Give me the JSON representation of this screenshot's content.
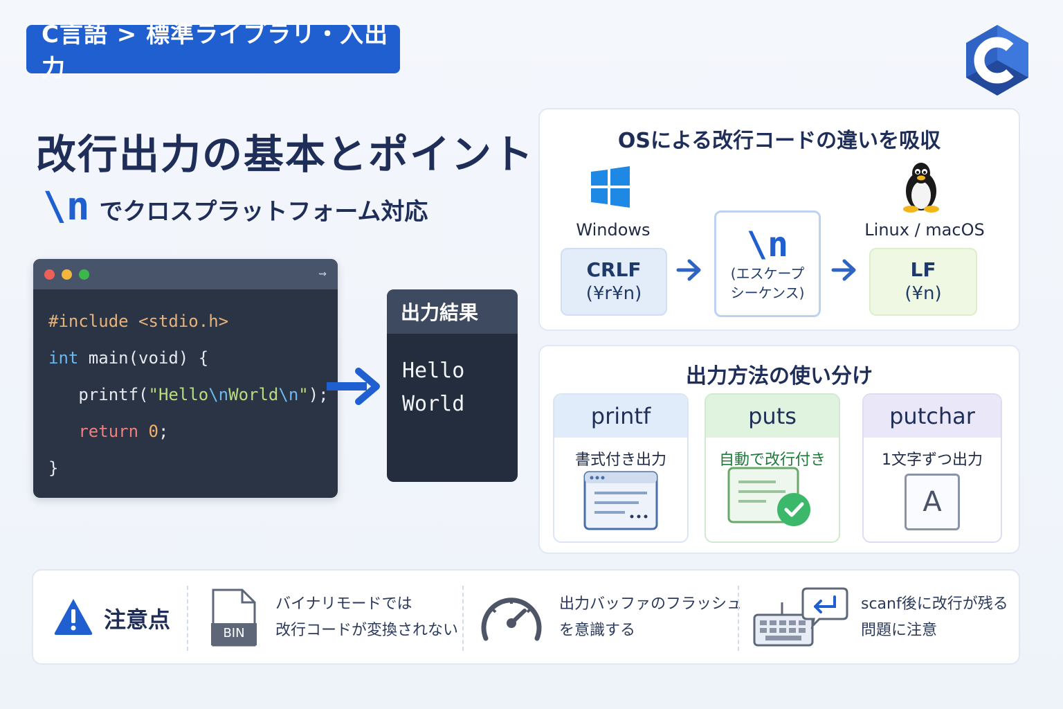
{
  "breadcrumb": "C言語 > 標準ライブラリ・入出力",
  "logo_icon": "c-language-logo",
  "title": "改行出力の基本とポイント",
  "subtitle": {
    "escape": "\\n",
    "text": "でクロスプラットフォーム対応"
  },
  "code": {
    "include": "#include <stdio.h>",
    "main_kw": "int",
    "main_rest": " main(void) {",
    "printf_fn": "printf(",
    "printf_str1": "\"Hello",
    "printf_esc1": "\\n",
    "printf_str2": "World",
    "printf_esc2": "\\n",
    "printf_str3": "\"",
    "printf_end": ");",
    "return_kw": "return",
    "return_val": "0",
    "return_end": ";",
    "close": "}"
  },
  "output": {
    "header": "出力結果",
    "line1": "Hello",
    "line2": "World"
  },
  "os_panel": {
    "title": "OSによる改行コードの違いを吸収",
    "windows_label": "Windows",
    "windows_code": "CRLF",
    "windows_seq": "(¥r¥n)",
    "escape_big": "\\n",
    "escape_line1": "(エスケープ",
    "escape_line2": "シーケンス)",
    "unix_label": "Linux / macOS",
    "unix_code": "LF",
    "unix_seq": "(¥n)"
  },
  "methods_panel": {
    "title": "出力方法の使い分け",
    "methods": [
      {
        "name": "printf",
        "desc": "書式付き出力",
        "color": "#dfeafb",
        "border": "#cfdcf1"
      },
      {
        "name": "puts",
        "desc": "自動で改行付き",
        "color": "#dff3df",
        "border": "#c8e8c8"
      },
      {
        "name": "putchar",
        "desc": "1文字ずつ出力",
        "color": "#e8e6f8",
        "border": "#d8d6ef"
      }
    ],
    "putchar_letter": "A"
  },
  "notes": {
    "heading": "注意点",
    "bin_label": "BIN",
    "note1_line1": "バイナリモードでは",
    "note1_line2": "改行コードが変換されない",
    "note2_line1": "出力バッファのフラッシュ",
    "note2_line2": "を意識する",
    "note3_line1": "scanf後に改行が残る",
    "note3_line2": "問題に注意"
  },
  "colors": {
    "accent": "#1f5fd0",
    "dark": "#1f2e58",
    "success": "#3cb86a"
  }
}
